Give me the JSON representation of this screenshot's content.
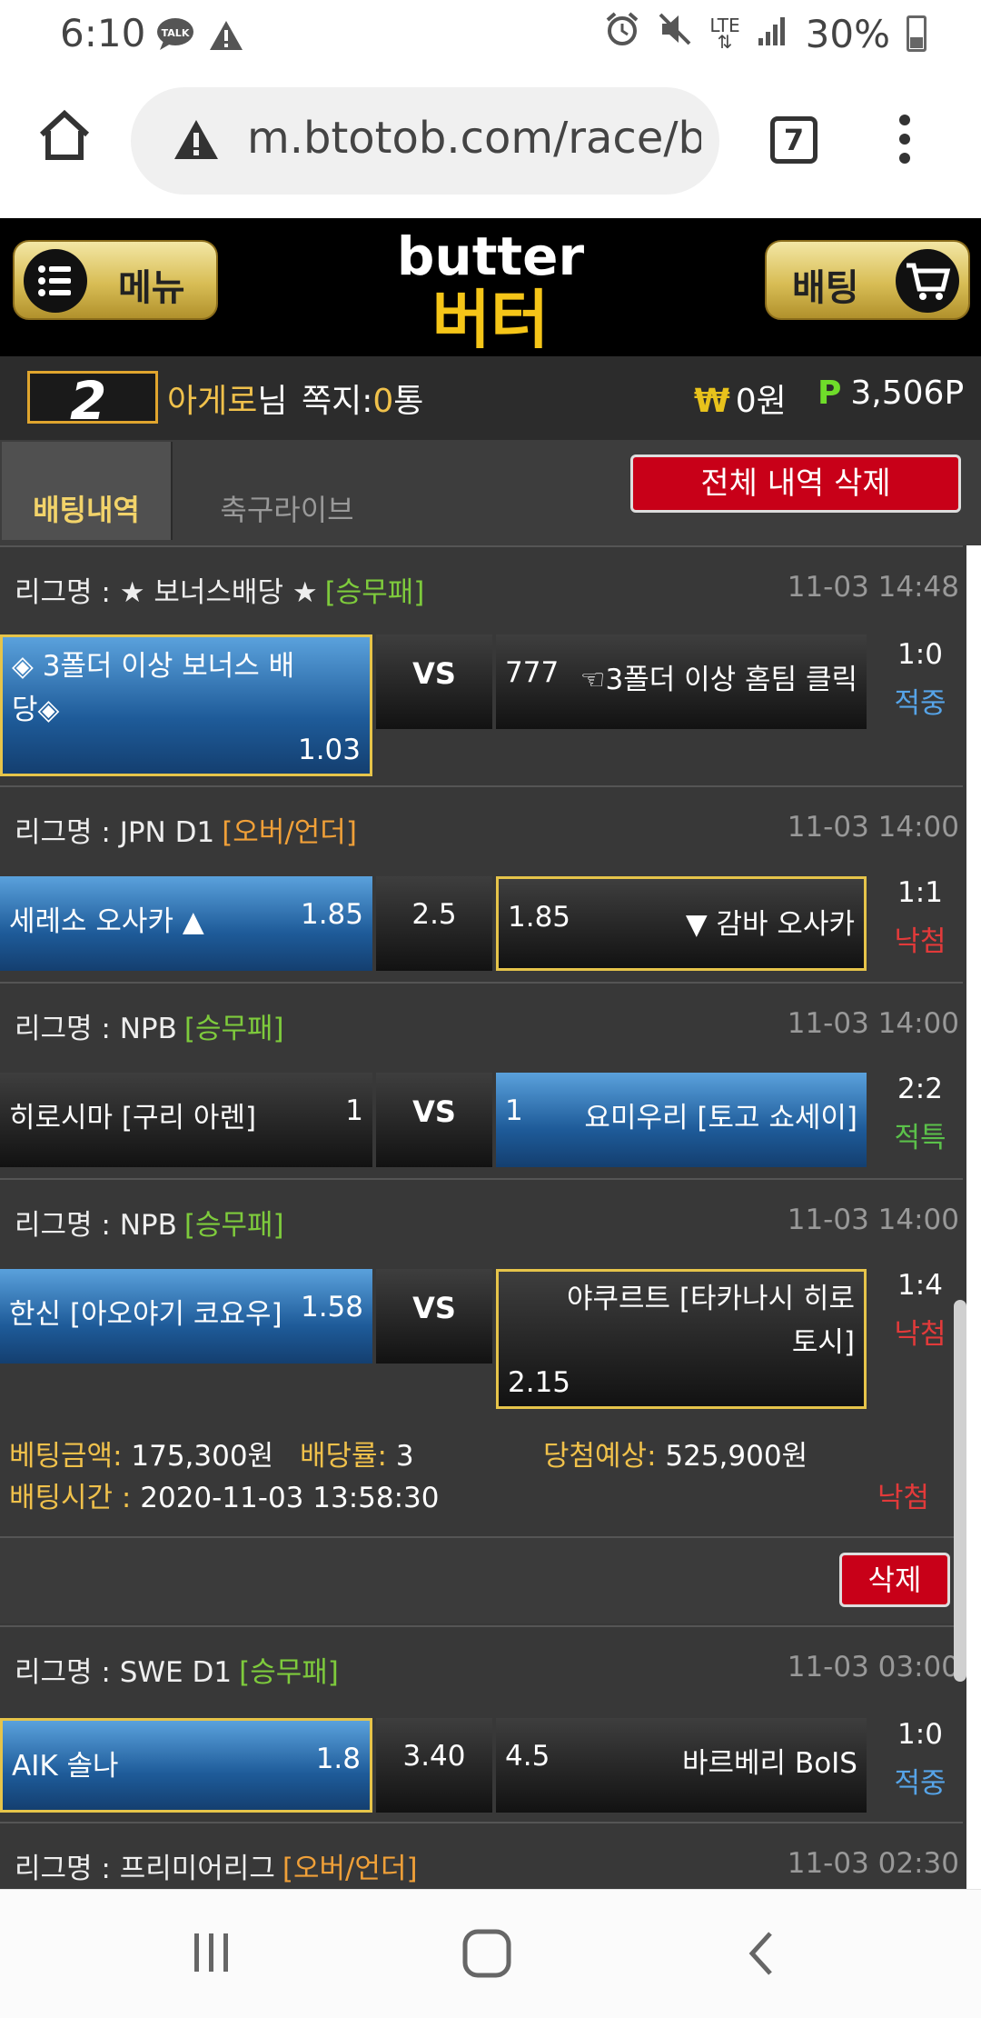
{
  "status_bar": {
    "time": "6:10",
    "battery": "30%",
    "network": "LTE"
  },
  "browser": {
    "url": "m.btotob.com/race/b",
    "tab_count": "7"
  },
  "header": {
    "menu_label": "메뉴",
    "bet_label": "배팅",
    "logo_en": "butter",
    "logo_kr": "버터"
  },
  "user": {
    "level": "2",
    "name": "아게로",
    "honorific": "님",
    "msg_label": "쪽지:",
    "msg_count": "0",
    "msg_unit": "통",
    "money": "0원",
    "points": "3,506P"
  },
  "tabs": {
    "active": "배팅내역",
    "other": "축구라이브",
    "delete_all": "전체 내역 삭제"
  },
  "league_prefix": "리그명 : ",
  "bets": [
    {
      "league": "★ 보너스배당 ★",
      "type": "[승무패]",
      "datetime": "11-03 14:48",
      "home": "◈ 3폴더 이상 보너스 배",
      "home2": "당◈",
      "home_odds": "1.03",
      "mid": "VS",
      "away": "777",
      "away_name": "☜3폴더 이상 홈팀 클릭",
      "score": "1:0",
      "status": "적중"
    },
    {
      "league": "JPN D1",
      "type": "[오버/언더]",
      "datetime": "11-03 14:00",
      "home": "세레소 오사카 ▲",
      "home_odds": "1.85",
      "mid": "2.5",
      "away_odds": "1.85",
      "away": "▼ 감바 오사카",
      "score": "1:1",
      "status": "낙첨"
    },
    {
      "league": "NPB",
      "type": "[승무패]",
      "datetime": "11-03 14:00",
      "home": "히로시마 [구리 아렌]",
      "home_odds": "1",
      "mid": "VS",
      "away_odds": "1",
      "away": "요미우리 [토고 쇼세이]",
      "score": "2:2",
      "status": "적특"
    },
    {
      "league": "NPB",
      "type": "[승무패]",
      "datetime": "11-03 14:00",
      "home": "한신 [아오야기 코요우]",
      "home_odds": "1.58",
      "mid": "VS",
      "away": "야쿠르트 [타카나시 히로",
      "away2": "토시]",
      "away_odds": "2.15",
      "score": "1:4",
      "status": "낙첨"
    }
  ],
  "summary": {
    "amount_label": "베팅금액:",
    "amount": "175,300원",
    "rate_label": "배당률:",
    "rate": "3",
    "expect_label": "당첨예상:",
    "expect": "525,900원",
    "time_label": "배팅시간 :",
    "time": "2020-11-03 13:58:30",
    "result": "낙첨",
    "delete_label": "삭제"
  },
  "bets2": [
    {
      "league": "SWE D1",
      "type": "[승무패]",
      "datetime": "11-03 03:00",
      "home": "AIK 솔나",
      "home_odds": "1.8",
      "mid": "3.40",
      "away_odds": "4.5",
      "away": "바르베리 BoIS",
      "score": "1:0",
      "status": "적중"
    },
    {
      "league": "프리미어리그",
      "type": "[오버/언더]",
      "datetime": "11-03 02:30"
    }
  ],
  "colors": {
    "accent_gold": "#f0c14b",
    "win_blue": "#56a4e8",
    "lose_red": "#e23a3a",
    "special_green": "#5bc14a",
    "delete_red": "#c80018"
  }
}
